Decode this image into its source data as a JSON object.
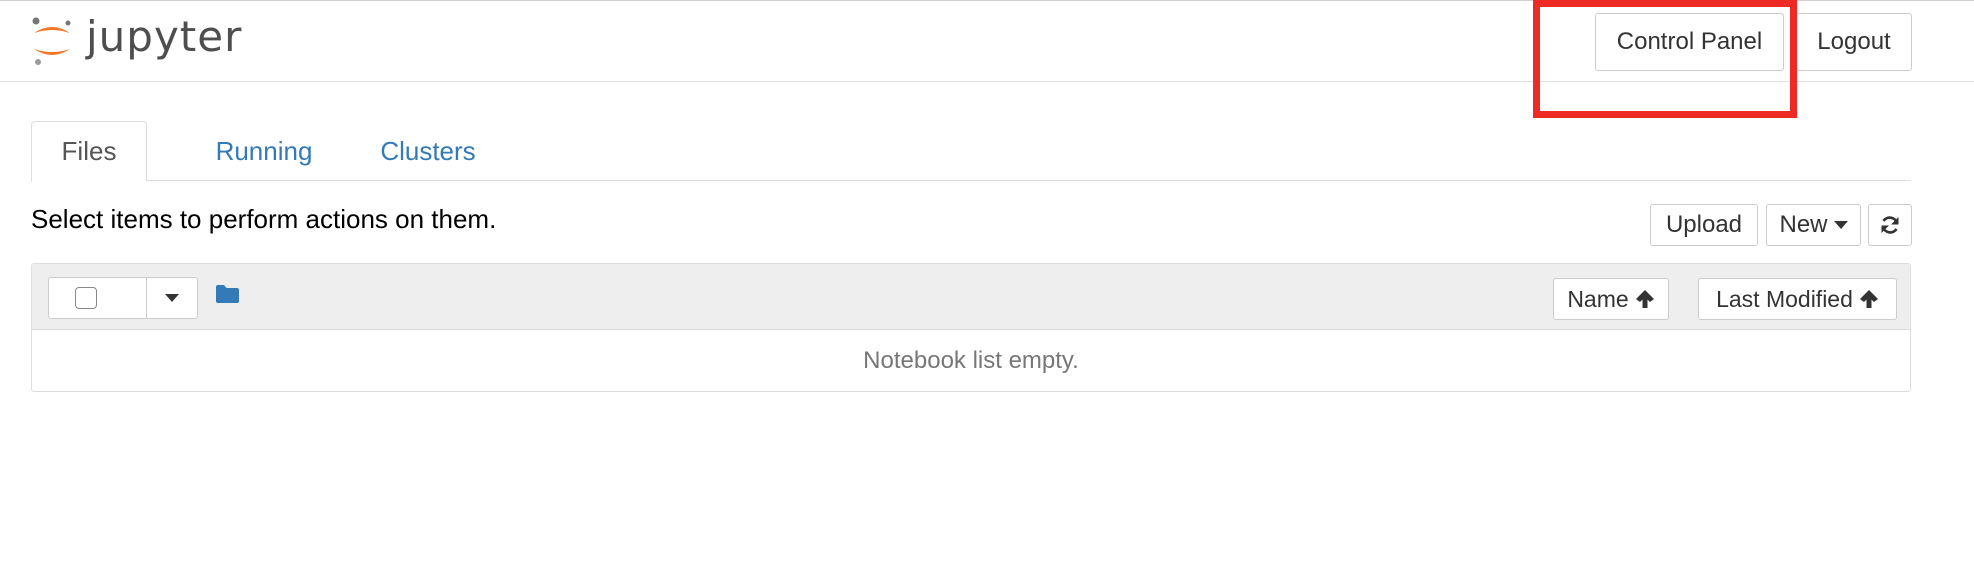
{
  "header": {
    "logo_text": "jupyter",
    "control_panel_label": "Control Panel",
    "logout_label": "Logout",
    "highlight_color": "#ee2a24"
  },
  "tabs": [
    {
      "label": "Files",
      "active": true
    },
    {
      "label": "Running",
      "active": false
    },
    {
      "label": "Clusters",
      "active": false
    }
  ],
  "toolbar": {
    "instruction": "Select items to perform actions on them.",
    "upload_label": "Upload",
    "new_label": "New",
    "refresh_icon": "refresh-icon"
  },
  "file_list": {
    "folder_icon": "folder-icon",
    "sort_name_label": "Name",
    "sort_modified_label": "Last Modified",
    "empty_message": "Notebook list empty."
  },
  "colors": {
    "link": "#337ab7",
    "jupyter_orange": "#f37726",
    "folder_blue": "#337ab7"
  }
}
